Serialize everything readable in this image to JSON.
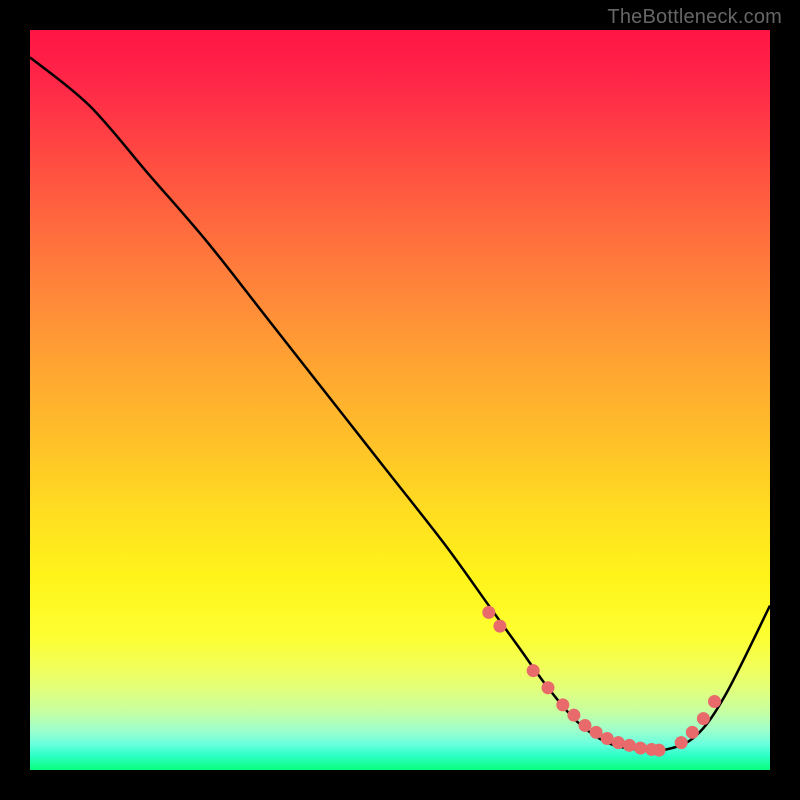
{
  "watermark": "TheBottleneck.com",
  "chart_data": {
    "type": "line",
    "title": "",
    "xlabel": "",
    "ylabel": "",
    "xlim": [
      0,
      100
    ],
    "ylim": [
      -4,
      104
    ],
    "series": [
      {
        "name": "curve",
        "x": [
          0,
          8,
          16,
          24,
          32,
          40,
          48,
          56,
          62,
          66,
          70,
          74,
          78,
          82,
          86,
          90,
          94,
          100
        ],
        "y": [
          100,
          93,
          83,
          73,
          62,
          51,
          40,
          29,
          20,
          14,
          8,
          3,
          0,
          -1,
          -1,
          1,
          7,
          20
        ]
      }
    ],
    "markers": {
      "name": "highlight-dots",
      "x": [
        62,
        63.5,
        68,
        70,
        72,
        73.5,
        75,
        76.5,
        78,
        79.5,
        81,
        82.5,
        84,
        85,
        88,
        89.5,
        91,
        92.5
      ],
      "y": [
        19,
        17,
        10.5,
        8,
        5.5,
        4,
        2.5,
        1.5,
        0.6,
        0,
        -0.4,
        -0.8,
        -1,
        -1.1,
        0,
        1.5,
        3.5,
        6
      ]
    },
    "background": "rainbow-vertical-gradient"
  }
}
